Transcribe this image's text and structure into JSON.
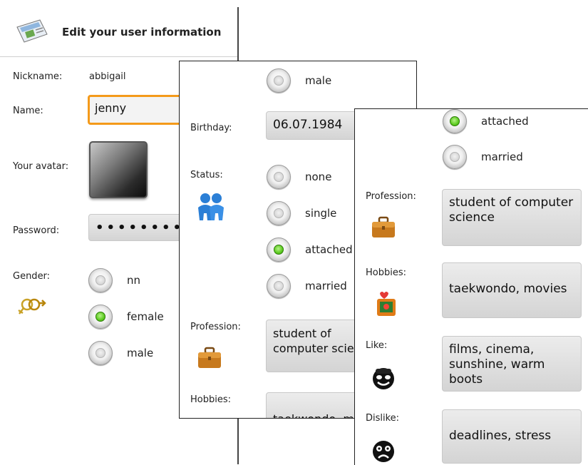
{
  "screen1": {
    "title": "Edit your user information",
    "nickname_label": "Nickname:",
    "nickname_value": "abbigail",
    "name_label": "Name:",
    "name_value": "jenny",
    "avatar_label": "Your avatar:",
    "password_label": "Password:",
    "password_value": "••••••••",
    "gender_label": "Gender:",
    "gender_options": [
      {
        "label": "nn",
        "checked": false
      },
      {
        "label": "female",
        "checked": true
      },
      {
        "label": "male",
        "checked": false
      }
    ]
  },
  "screen2": {
    "top_option": "male",
    "birthday_label": "Birthday:",
    "birthday_value": "06.07.1984",
    "status_label": "Status:",
    "status_options": [
      {
        "label": "none",
        "checked": false
      },
      {
        "label": "single",
        "checked": false
      },
      {
        "label": "attached",
        "checked": true
      },
      {
        "label": "married",
        "checked": false
      }
    ],
    "profession_label": "Profession:",
    "profession_value": "student of computer scie",
    "hobbies_label": "Hobbies:",
    "hobbies_value": "taekwondo, m"
  },
  "screen3": {
    "status_options": [
      {
        "label": "attached",
        "checked": true
      },
      {
        "label": "married",
        "checked": false
      }
    ],
    "profession_label": "Profession:",
    "profession_value": "student of computer science",
    "hobbies_label": "Hobbies:",
    "hobbies_value": "taekwondo, movies",
    "like_label": "Like:",
    "like_value": "films, cinema, sunshine, warm boots",
    "dislike_label": "Dislike:",
    "dislike_value": "deadlines, stress"
  },
  "colors": {
    "focus_border": "#f49a1a",
    "radio_checked": "#5ccb1f"
  },
  "icons": [
    "id-card-icon",
    "gender-icon",
    "couple-icon",
    "briefcase-icon",
    "hobby-icon",
    "happy-smiley-icon",
    "sad-smiley-icon"
  ]
}
